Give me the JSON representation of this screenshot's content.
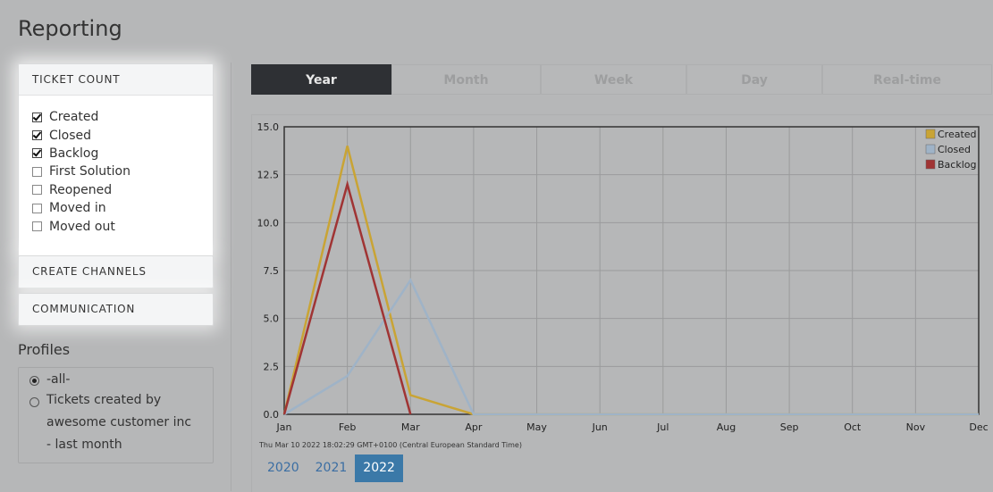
{
  "page": {
    "title": "Reporting"
  },
  "sidebar": {
    "ticket_count": {
      "label": "TICKET COUNT",
      "items": [
        {
          "label": "Created",
          "checked": true
        },
        {
          "label": "Closed",
          "checked": true
        },
        {
          "label": "Backlog",
          "checked": true
        },
        {
          "label": "First Solution",
          "checked": false
        },
        {
          "label": "Reopened",
          "checked": false
        },
        {
          "label": "Moved in",
          "checked": false
        },
        {
          "label": "Moved out",
          "checked": false
        }
      ]
    },
    "create_channels": {
      "label": "CREATE CHANNELS"
    },
    "communication": {
      "label": "COMMUNICATION"
    },
    "profiles": {
      "title": "Profiles",
      "options": [
        {
          "label": "-all-",
          "selected": true
        },
        {
          "label": "Tickets created by awesome customer inc - last month",
          "selected": false
        }
      ]
    }
  },
  "tabs": [
    {
      "label": "Year",
      "active": true
    },
    {
      "label": "Month",
      "active": false
    },
    {
      "label": "Week",
      "active": false
    },
    {
      "label": "Day",
      "active": false
    },
    {
      "label": "Real-time",
      "active": false
    }
  ],
  "timestamp": "Thu Mar 10 2022 18:02:29 GMT+0100 (Central European Standard Time)",
  "years": [
    {
      "label": "2020",
      "active": false
    },
    {
      "label": "2021",
      "active": false
    },
    {
      "label": "2022",
      "active": true
    }
  ],
  "colors": {
    "created": "#c9a435",
    "closed": "#9fb3c7",
    "backlog": "#a03434",
    "active_tab": "#2e3034",
    "active_year": "#3b79a8"
  },
  "chart_data": {
    "type": "line",
    "categories": [
      "Jan",
      "Feb",
      "Mar",
      "Apr",
      "May",
      "Jun",
      "Jul",
      "Aug",
      "Sep",
      "Oct",
      "Nov",
      "Dec"
    ],
    "ylim": [
      0,
      15
    ],
    "yticks": [
      "0.0",
      "2.5",
      "5.0",
      "7.5",
      "10.0",
      "12.5",
      "15.0"
    ],
    "legend_position": "top-right",
    "grid": true,
    "series": [
      {
        "name": "Created",
        "color": "#c9a435",
        "values": [
          0,
          14,
          1,
          0,
          0,
          0,
          0,
          0,
          0,
          0,
          0,
          0
        ]
      },
      {
        "name": "Closed",
        "color": "#9fb3c7",
        "values": [
          0,
          2,
          7,
          0,
          0,
          0,
          0,
          0,
          0,
          0,
          0,
          0
        ]
      },
      {
        "name": "Backlog",
        "color": "#a03434",
        "values": [
          0,
          12,
          0,
          0,
          0,
          0,
          0,
          0,
          0,
          0,
          0,
          0
        ],
        "end_index": 2
      }
    ]
  }
}
